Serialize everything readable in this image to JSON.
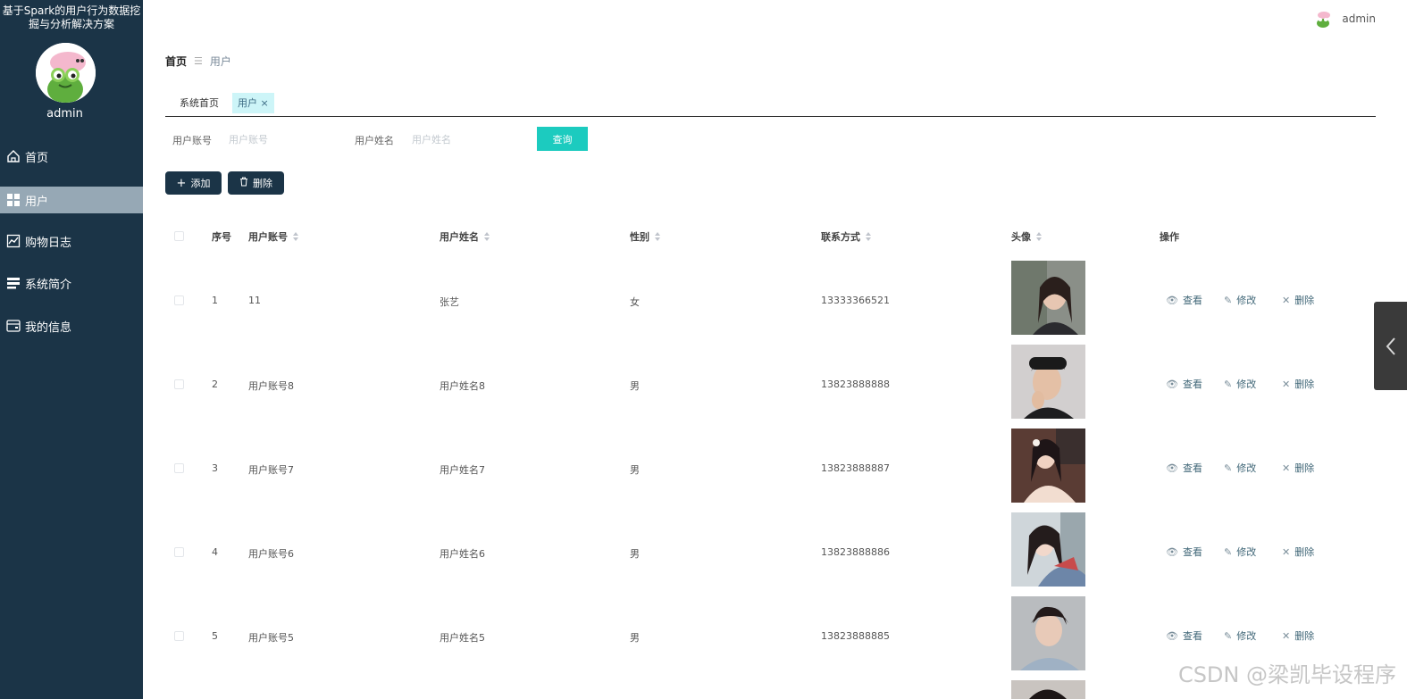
{
  "sidebar": {
    "brand_line1": "基于Spark的用户行为数据挖",
    "brand_line2": "掘与分析解决方案",
    "user_name": "admin",
    "items": [
      {
        "label": "首页"
      },
      {
        "label": "用户"
      },
      {
        "label": "购物日志"
      },
      {
        "label": "系统简介"
      },
      {
        "label": "我的信息"
      }
    ]
  },
  "topbar": {
    "user_name": "admin"
  },
  "breadcrumb": {
    "home": "首页",
    "separator": "☰",
    "current": "用户"
  },
  "tabs": [
    {
      "label": "系统首页"
    },
    {
      "label": "用户",
      "close": "×"
    }
  ],
  "search": {
    "account_label": "用户账号",
    "account_placeholder": "用户账号",
    "name_label": "用户姓名",
    "name_placeholder": "用户姓名",
    "query_button": "查询"
  },
  "actions": {
    "add": "添加",
    "delete": "删除"
  },
  "table": {
    "headers": {
      "index": "序号",
      "account": "用户账号",
      "name": "用户姓名",
      "gender": "性别",
      "contact": "联系方式",
      "avatar": "头像",
      "ops": "操作"
    },
    "op_labels": {
      "view": "查看",
      "edit": "修改",
      "delete": "删除"
    },
    "rows": [
      {
        "index": "1",
        "account": "11",
        "name": "张艺",
        "gender": "女",
        "contact": "13333366521"
      },
      {
        "index": "2",
        "account": "用户账号8",
        "name": "用户姓名8",
        "gender": "男",
        "contact": "13823888888"
      },
      {
        "index": "3",
        "account": "用户账号7",
        "name": "用户姓名7",
        "gender": "男",
        "contact": "13823888887"
      },
      {
        "index": "4",
        "account": "用户账号6",
        "name": "用户姓名6",
        "gender": "男",
        "contact": "13823888886"
      },
      {
        "index": "5",
        "account": "用户账号5",
        "name": "用户姓名5",
        "gender": "男",
        "contact": "13823888885"
      }
    ]
  },
  "watermark": "CSDN @梁凯毕设程序",
  "colors": {
    "sidebar_bg": "#1b3447",
    "active_nav": "#96a8b5",
    "query_button": "#1ccbbf",
    "active_tab": "#cdf5f8"
  }
}
